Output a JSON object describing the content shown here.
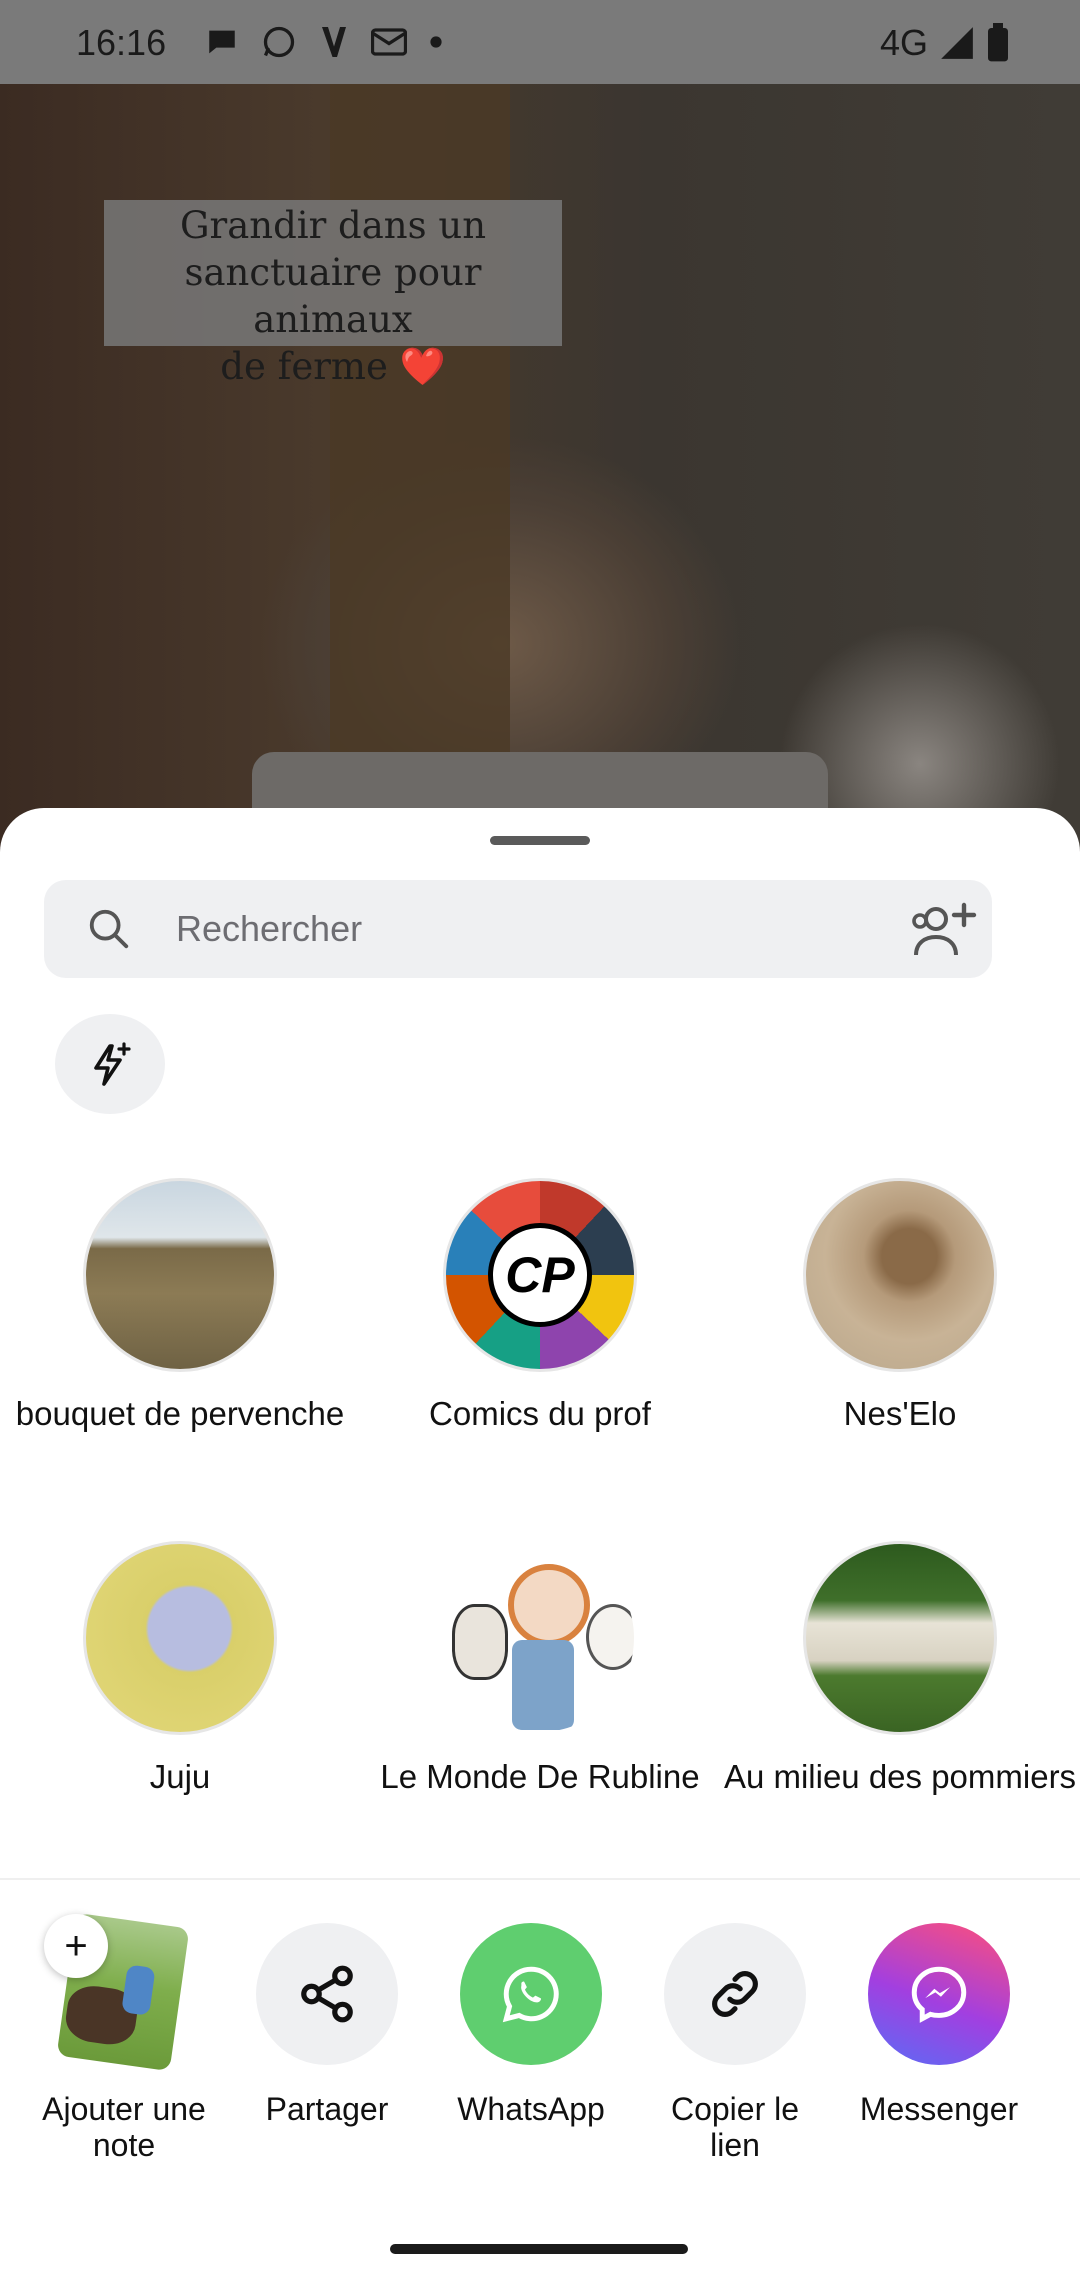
{
  "status_bar": {
    "time": "16:16",
    "network": "4G",
    "notification_icons": [
      "chat-icon",
      "whatsapp-icon",
      "v-app-icon",
      "mail-icon",
      "dot-icon"
    ]
  },
  "video": {
    "caption_line1": "Grandir dans un",
    "caption_line2": "sanctuaire pour animaux",
    "caption_line3": "de ferme ❤️"
  },
  "share_sheet": {
    "search_placeholder": "Rechercher",
    "contacts": [
      {
        "name": "bouquet de pervenche"
      },
      {
        "name": "Comics du prof"
      },
      {
        "name": "Nes'Elo"
      },
      {
        "name": "Juju"
      },
      {
        "name": "Le Monde De Rubline"
      },
      {
        "name": "Au milieu des pommiers"
      }
    ],
    "actions": [
      {
        "label": "Ajouter une note"
      },
      {
        "label": "Partager"
      },
      {
        "label": "WhatsApp"
      },
      {
        "label": "Copier le lien"
      },
      {
        "label": "Messenger"
      }
    ],
    "comics_logo_text": "CP"
  },
  "colors": {
    "whatsapp": "#5fce6f",
    "messenger_start": "#a23fe0",
    "messenger_end": "#ff4f7a",
    "sheet_bg": "#ffffff",
    "search_bg": "#eff0f2"
  }
}
